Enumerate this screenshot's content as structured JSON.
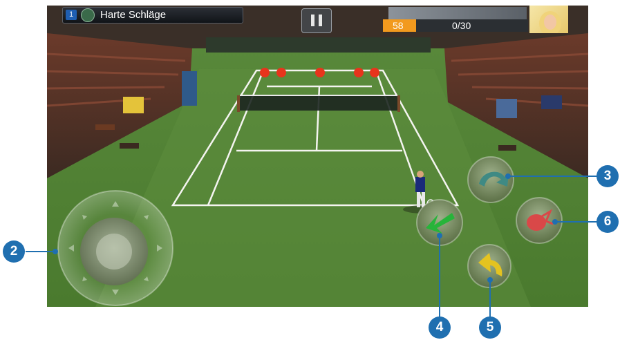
{
  "hud": {
    "level": "1",
    "title": "Harte Schläge",
    "score": "58",
    "progress": "0/30",
    "progress_fraction": 0.0
  },
  "targets": 5,
  "controls": {
    "joystick_icon": "joystick",
    "btn3_icon": "lob-arrow-icon",
    "btn4_icon": "slice-arrow-icon",
    "btn5_icon": "topspin-arrow-icon",
    "btn6_icon": "power-shot-icon"
  },
  "callouts": [
    "2",
    "3",
    "4",
    "5",
    "6"
  ],
  "colors": {
    "accent_blue": "#1f6fb0",
    "score_orange": "#f29a1e",
    "target_red": "#e8341c"
  }
}
